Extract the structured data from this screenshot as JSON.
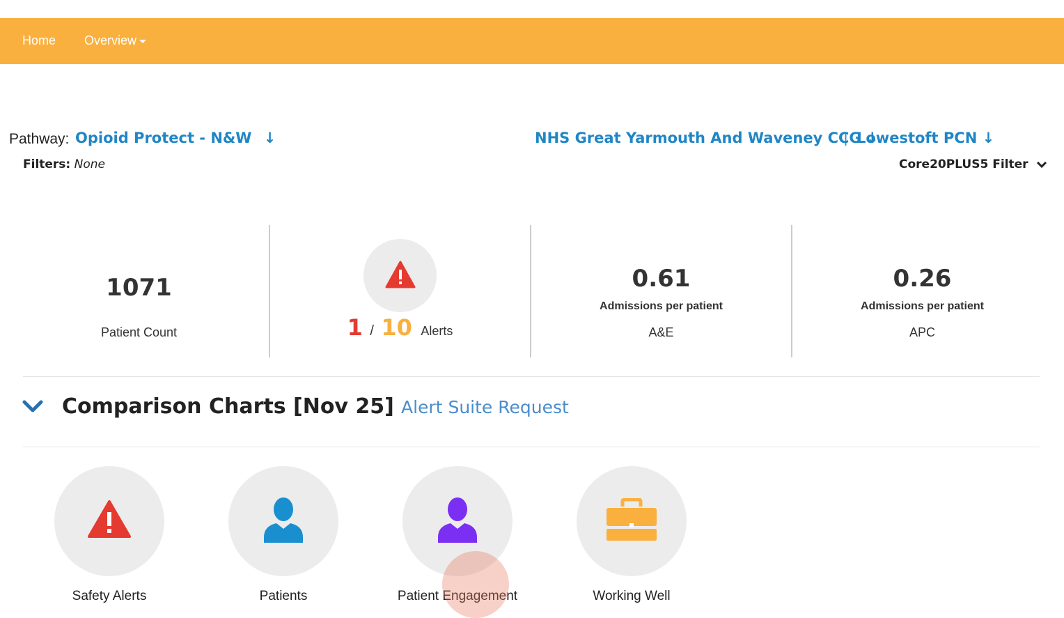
{
  "nav": {
    "home": "Home",
    "overview": "Overview"
  },
  "pathway": {
    "label": "Pathway:",
    "name": "Opioid Protect - N&W",
    "arrow": "↓"
  },
  "org": {
    "ccg": "NHS Great Yarmouth And Waveney CCG",
    "ccg_arrow": "↓",
    "separator": "|",
    "pcn": "Lowestoft PCN",
    "pcn_arrow": "↓"
  },
  "filters": {
    "label": "Filters:",
    "value": "None",
    "core_filter": "Core20PLUS5 Filter"
  },
  "stats": {
    "patient_count": {
      "value": "1071",
      "label": "Patient Count"
    },
    "alerts": {
      "active": "1",
      "separator": "/",
      "total": "10",
      "label": "Alerts"
    },
    "ae": {
      "value": "0.61",
      "sub": "Admissions per patient",
      "label": "A&E"
    },
    "apc": {
      "value": "0.26",
      "sub": "Admissions per patient",
      "label": "APC"
    }
  },
  "section": {
    "title": "Comparison Charts [Nov 25]",
    "link": "Alert Suite Request"
  },
  "tiles": [
    {
      "label": "Safety Alerts",
      "icon": "warning-icon",
      "color": "#e53a30"
    },
    {
      "label": "Patients",
      "icon": "person-icon",
      "color": "#1a8fd0"
    },
    {
      "label": "Patient Engagement",
      "icon": "person-icon",
      "color": "#7b2ff2"
    },
    {
      "label": "Working Well",
      "icon": "briefcase-icon",
      "color": "#f9b03f"
    }
  ],
  "colors": {
    "topbar": "#f9b03f",
    "link": "#1f86c6",
    "alert_red": "#e53a30",
    "alert_orange": "#f9b03f"
  }
}
